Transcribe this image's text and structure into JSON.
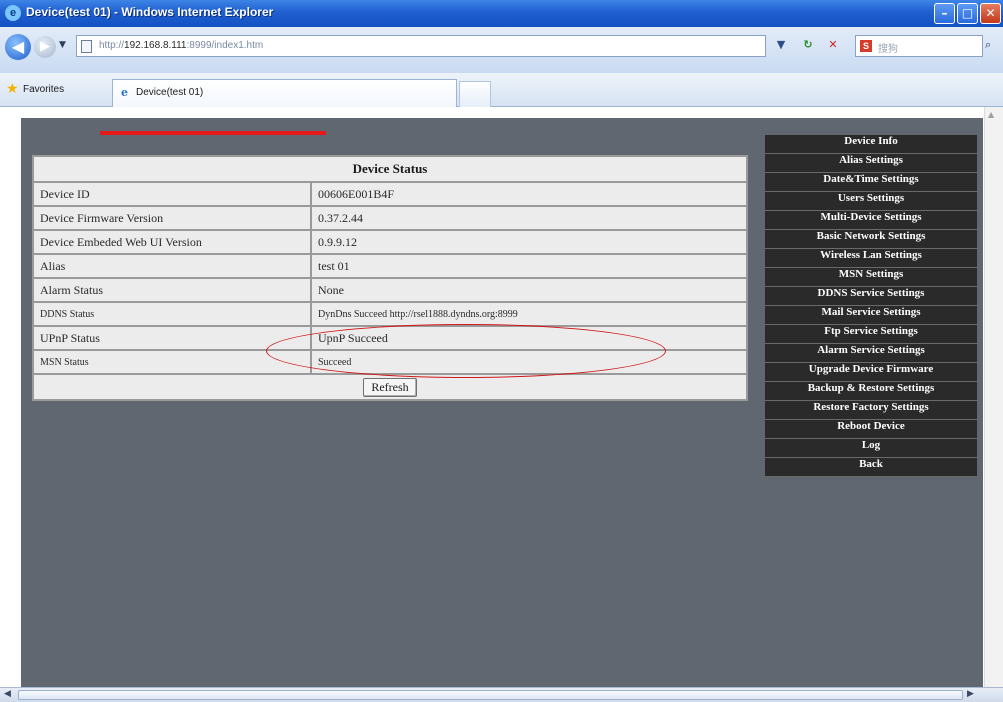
{
  "window": {
    "title": "Device(test 01) - Windows Internet Explorer",
    "minimize_glyph": "–",
    "maximize_glyph": "□",
    "close_glyph": "✕"
  },
  "toolbar": {
    "back_glyph": "◀",
    "forward_glyph": "▶",
    "dropdown_glyph": "▼",
    "url_prefix": "http://",
    "url_host": "192.168.8.111",
    "url_rest": ":8999/index1.htm",
    "refresh_glyph": "↻",
    "stop_glyph": "✕",
    "search_provider": "S",
    "search_placeholder": "搜狗",
    "search_glyph": "⌕"
  },
  "favorites": {
    "label": "Favorites",
    "tab_label": "Device(test 01)"
  },
  "status": {
    "header": "Device Status",
    "rows": [
      {
        "label": "Device ID",
        "value": "00606E001B4F"
      },
      {
        "label": "Device Firmware Version",
        "value": "0.37.2.44"
      },
      {
        "label": "Device Embeded Web UI Version",
        "value": "0.9.9.12"
      },
      {
        "label": "Alias",
        "value": "test 01"
      },
      {
        "label": "Alarm Status",
        "value": "None"
      },
      {
        "label": "DDNS Status",
        "value": "DynDns Succeed http://rsel1888.dyndns.org:8999"
      },
      {
        "label": "UPnP Status",
        "value": "UpnP Succeed"
      },
      {
        "label": "MSN Status",
        "value": "Succeed"
      }
    ],
    "refresh_label": "Refresh"
  },
  "menu": [
    "Device Info",
    "Alias Settings",
    "Date&Time Settings",
    "Users Settings",
    "Multi-Device Settings",
    "Basic Network Settings",
    "Wireless Lan Settings",
    "MSN Settings",
    "DDNS Service Settings",
    "Mail Service Settings",
    "Ftp Service Settings",
    "Alarm Service Settings",
    "Upgrade Device Firmware",
    "Backup & Restore Settings",
    "Restore Factory Settings",
    "Reboot Device",
    "Log",
    "Back"
  ],
  "scroll": {
    "left_glyph": "◀",
    "right_glyph": "▶",
    "up_glyph": "▲"
  }
}
